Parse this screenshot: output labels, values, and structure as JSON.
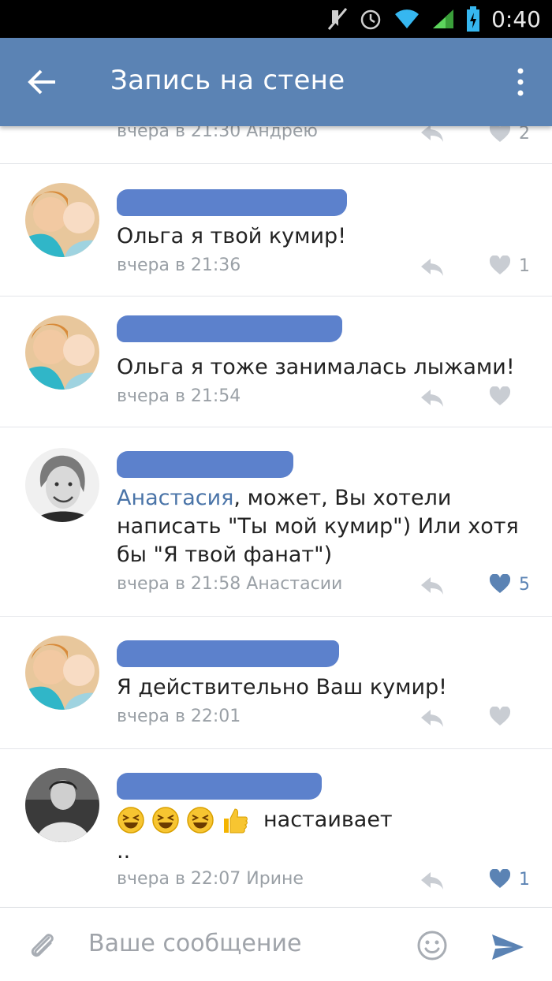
{
  "status_bar": {
    "time": "0:40"
  },
  "header": {
    "title": "Запись на стене"
  },
  "partial_comment": {
    "meta": "вчера в 21:30 Андрею",
    "likes": "2"
  },
  "comments": [
    {
      "text": "Ольга я твой кумир!",
      "meta": "вчера в 21:36",
      "likes": "1",
      "liked": false
    },
    {
      "text": "Ольга я тоже занималась лыжами!",
      "meta": "вчера в 21:54",
      "likes": "",
      "liked": false
    },
    {
      "mention": "Анастасия",
      "text_line1": ", может, Вы хотели",
      "text_line2": "написать \"Ты мой кумир\") Или хотя",
      "text_line3": "бы \"Я твой фанат\")",
      "meta": "вчера в 21:58 Анастасии",
      "likes": "5",
      "liked": true
    },
    {
      "text": "Я действительно Ваш кумир!",
      "meta": "вчера в 22:01",
      "likes": "",
      "liked": false
    },
    {
      "text": "настаивает",
      "text_line2": "..",
      "meta": "вчера в 22:07 Ирине",
      "likes": "1",
      "liked": true
    }
  ],
  "composer": {
    "placeholder": "Ваше сообщение"
  },
  "colors": {
    "header": "#5b83b4",
    "mention": "#4a74a8",
    "like_active": "#5b83b4",
    "meta": "#9aa0a6"
  }
}
